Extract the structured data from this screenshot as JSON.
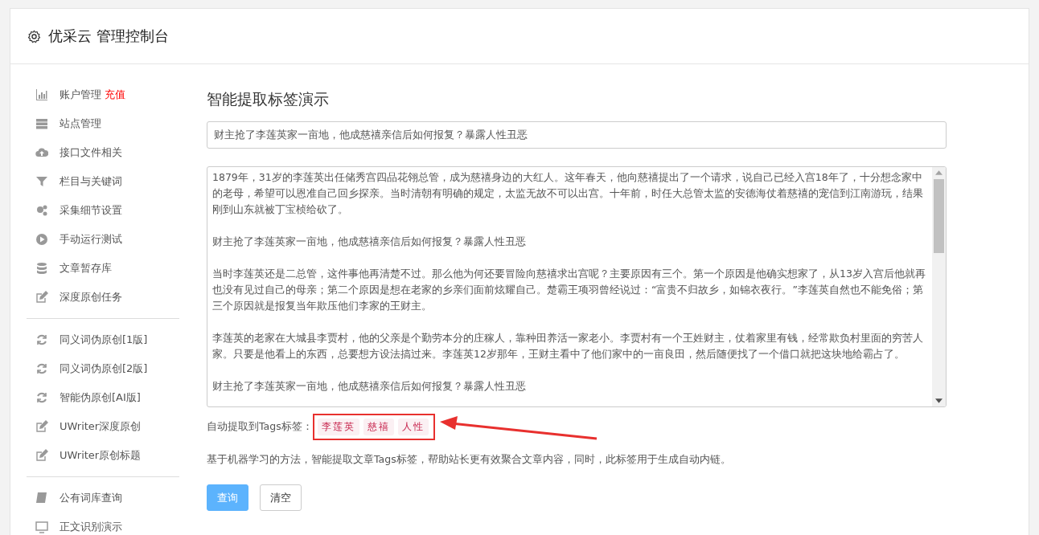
{
  "header": {
    "title": "优采云 管理控制台"
  },
  "sidebar": {
    "groups": [
      {
        "items": [
          {
            "label": "账户管理",
            "kind": "chart",
            "badge": "充值"
          },
          {
            "label": "站点管理",
            "kind": "server"
          },
          {
            "label": "接口文件相关",
            "kind": "cloud"
          },
          {
            "label": "栏目与关键词",
            "kind": "filter"
          },
          {
            "label": "采集细节设置",
            "kind": "gears"
          },
          {
            "label": "手动运行测试",
            "kind": "play"
          },
          {
            "label": "文章暂存库",
            "kind": "database"
          },
          {
            "label": "深度原创任务",
            "kind": "edit"
          }
        ]
      },
      {
        "items": [
          {
            "label": "同义词伪原创[1版]",
            "kind": "refresh"
          },
          {
            "label": "同义词伪原创[2版]",
            "kind": "refresh"
          },
          {
            "label": "智能伪原创[AI版]",
            "kind": "refresh"
          },
          {
            "label": "UWriter深度原创",
            "kind": "edit"
          },
          {
            "label": "UWriter原创标题",
            "kind": "edit"
          }
        ]
      },
      {
        "items": [
          {
            "label": "公有词库查询",
            "kind": "book"
          },
          {
            "label": "正文识别演示",
            "kind": "monitor"
          }
        ]
      }
    ]
  },
  "main": {
    "heading": "智能提取标签演示",
    "title_field": {
      "value": "财主抢了李莲英家一亩地，他成慈禧亲信后如何报复？暴露人性丑恶"
    },
    "content_field": {
      "paragraphs": [
        "1879年，31岁的李莲英出任储秀宫四品花翎总管，成为慈禧身边的大红人。这年春天，他向慈禧提出了一个请求，说自己已经入宫18年了，十分想念家中的老母，希望可以恩准自己回乡探亲。当时清朝有明确的规定，太监无故不可以出宫。十年前，时任大总管太监的安德海仗着慈禧的宠信到江南游玩，结果刚到山东就被丁宝桢给砍了。",
        "财主抢了李莲英家一亩地，他成慈禧亲信后如何报复？暴露人性丑恶",
        "当时李莲英还是二总管，这件事他再清楚不过。那么他为何还要冒险向慈禧求出宫呢？主要原因有三个。第一个原因是他确实想家了，从13岁入宫后他就再也没有见过自己的母亲；第二个原因是想在老家的乡亲们面前炫耀自己。楚霸王项羽曾经说过：“富贵不归故乡，如锦衣夜行。”李莲英自然也不能免俗；第三个原因就是报复当年欺压他们李家的王财主。",
        "李莲英的老家在大城县李贾村，他的父亲是个勤劳本分的庄稼人，靠种田养活一家老小。李贾村有一个王姓财主，仗着家里有钱，经常欺负村里面的穷苦人家。只要是他看上的东西，总要想方设法搞过来。李莲英12岁那年，王财主看中了他们家中的一亩良田，然后随便找了一个借口就把这块地给霸占了。",
        "财主抢了李莲英家一亩地，他成慈禧亲信后如何报复？暴露人性丑恶"
      ]
    },
    "tags_label": "自动提取到Tags标签：",
    "tags": [
      "李莲英",
      "慈禧",
      "人性"
    ],
    "description": "基于机器学习的方法，智能提取文章Tags标签，帮助站长更有效聚合文章内容，同时，此标签用于生成自动内链。",
    "buttons": [
      {
        "label": "查询",
        "kind": "primary"
      },
      {
        "label": "清空",
        "kind": "default"
      }
    ]
  }
}
